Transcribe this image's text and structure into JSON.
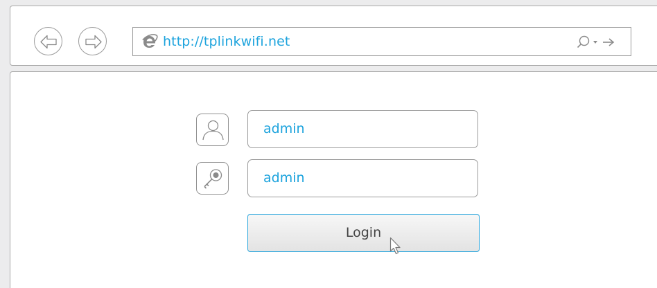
{
  "browser": {
    "url": "http://tplinkwifi.net",
    "icons": {
      "back": "back-arrow-icon",
      "forward": "forward-arrow-icon",
      "page": "internet-explorer-icon",
      "search": "search-icon",
      "dropdown": "dropdown-arrow-icon",
      "go": "go-arrow-icon"
    }
  },
  "login_form": {
    "username_value": "admin",
    "password_value": "admin",
    "login_label": "Login",
    "icons": {
      "username": "user-icon",
      "password": "key-icon"
    }
  },
  "colors": {
    "accent": "#1ca3dd",
    "button_border": "#2ea8de",
    "frame_border": "#a8a8a8"
  }
}
